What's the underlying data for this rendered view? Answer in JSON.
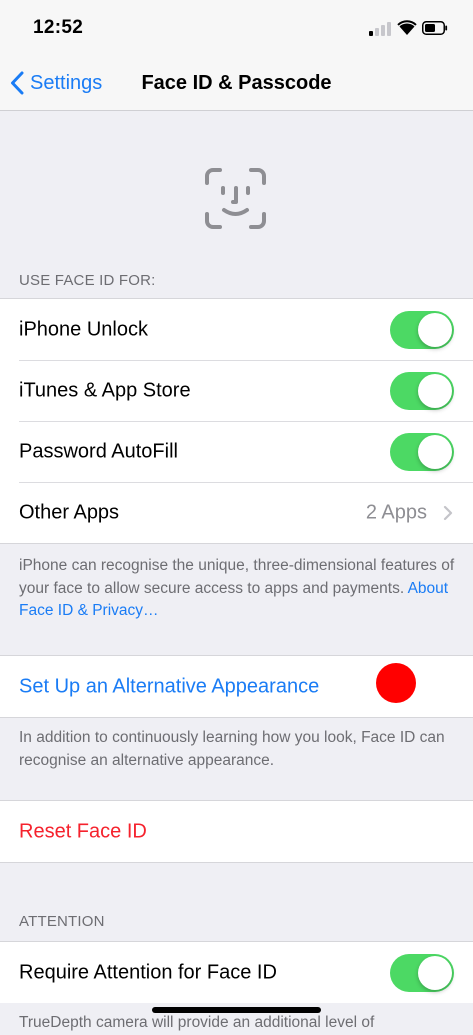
{
  "status_bar": {
    "time": "12:52"
  },
  "nav": {
    "back_label": "Settings",
    "title": "Face ID & Passcode"
  },
  "use_face_id": {
    "header": "USE FACE ID FOR:",
    "rows": [
      {
        "label": "iPhone Unlock",
        "toggle": "on"
      },
      {
        "label": "iTunes & App Store",
        "toggle": "on"
      },
      {
        "label": "Password AutoFill",
        "toggle": "on"
      },
      {
        "label": "Other Apps",
        "value": "2 Apps"
      }
    ],
    "footer_text": "iPhone can recognise the unique, three-dimensional features of your face to allow secure access to apps and payments.",
    "footer_link": "About Face ID & Privacy…"
  },
  "alternative": {
    "label": "Set Up an Alternative Appearance",
    "footer_text": "In addition to continuously learning how you look, Face ID can recognise an alternative appearance."
  },
  "reset": {
    "label": "Reset Face ID"
  },
  "attention": {
    "header": "ATTENTION",
    "rows": [
      {
        "label": "Require Attention for Face ID",
        "toggle": "on"
      }
    ],
    "footer_text": "TrueDepth camera will provide an additional level of"
  },
  "colors": {
    "accent": "#1a7cf5",
    "toggle_on": "#4cd964",
    "destructive": "#f5222d",
    "touch_marker": "#ff0000"
  }
}
